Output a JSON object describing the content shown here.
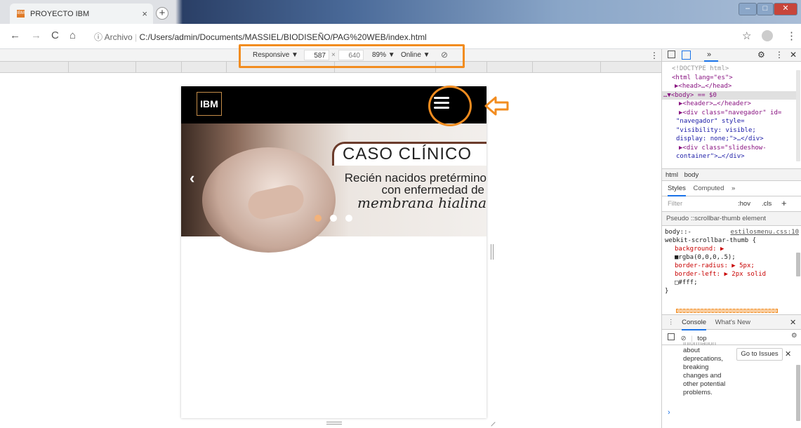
{
  "browser": {
    "tab_title": "PROYECTO IBM",
    "tab_favicon": "IBM",
    "tab_close": "×",
    "new_tab": "+",
    "window_controls": [
      "–",
      "□",
      "✕"
    ],
    "nav": {
      "back": "←",
      "forward": "→",
      "reload": "C",
      "home": "⌂"
    },
    "url_info": "ⓘ Archivo",
    "url_path": "C:/Users/admin/Documents/MASSIEL/BIODISEÑO/PAG%20WEB/index.html",
    "star": "☆",
    "menu": "⋮"
  },
  "device_toolbar": {
    "device": "Responsive ▼",
    "width": "587",
    "times": "×",
    "height": "640",
    "zoom": "89% ▼",
    "throttle": "Online ▼",
    "rotate": "⃠",
    "more": "⋮"
  },
  "site": {
    "logo": "IBM",
    "slide_title": "CASO CLÍNICO",
    "slide_line1": "Recién nacidos pretérmino",
    "slide_line2": "con enfermedad de",
    "slide_line3": "membrana hialina",
    "prev": "‹",
    "dots": [
      "#f3b27a",
      "#ffffff",
      "#ffffff"
    ]
  },
  "devtools": {
    "more_tabs": "»",
    "dom": {
      "doctype": "<!DOCTYPE html>",
      "html_open": "<html lang=\"es\">",
      "head": "▶<head>…</head>",
      "body": "…▼<body> == $0",
      "header": "▶<header>…</header>",
      "div1a": "▶<div class=\"navegador\" id=",
      "div1b": "\"navegador\" style=",
      "div1c": "\"visibility: visible;",
      "div1d": "display: none;\">…</div>",
      "div2a": "▶<div class=\"slideshow-",
      "div2b": "container\">…</div>"
    },
    "breadcrumb": [
      "html",
      "body"
    ],
    "styles_tab": "Styles",
    "computed_tab": "Computed",
    "filter_placeholder": "Filter",
    "hov": ":hov",
    "cls": ".cls",
    "plus": "+",
    "pseudo_label": "Pseudo ::scrollbar-thumb element",
    "rule_selector": "body::-",
    "rule_selector2": "webkit-scrollbar-thumb {",
    "rule_source": "estilosmenu.css:10",
    "rule_props": [
      "background: ▶",
      "  ■rgba(0,0,0,.5);",
      "border-radius: ▶ 5px;",
      "border-left: ▶ 2px solid",
      "  □#fff;"
    ],
    "rule_close": "}",
    "console_tab": "Console",
    "whats_new_tab": "What's New",
    "console_context": "top",
    "issues_button": "Go to Issues",
    "console_message": [
      "information",
      "about",
      "deprecations,",
      "breaking",
      "changes and",
      "other potential",
      "problems."
    ],
    "prompt": "›"
  },
  "colors": {
    "highlight": "#f28c1f"
  }
}
